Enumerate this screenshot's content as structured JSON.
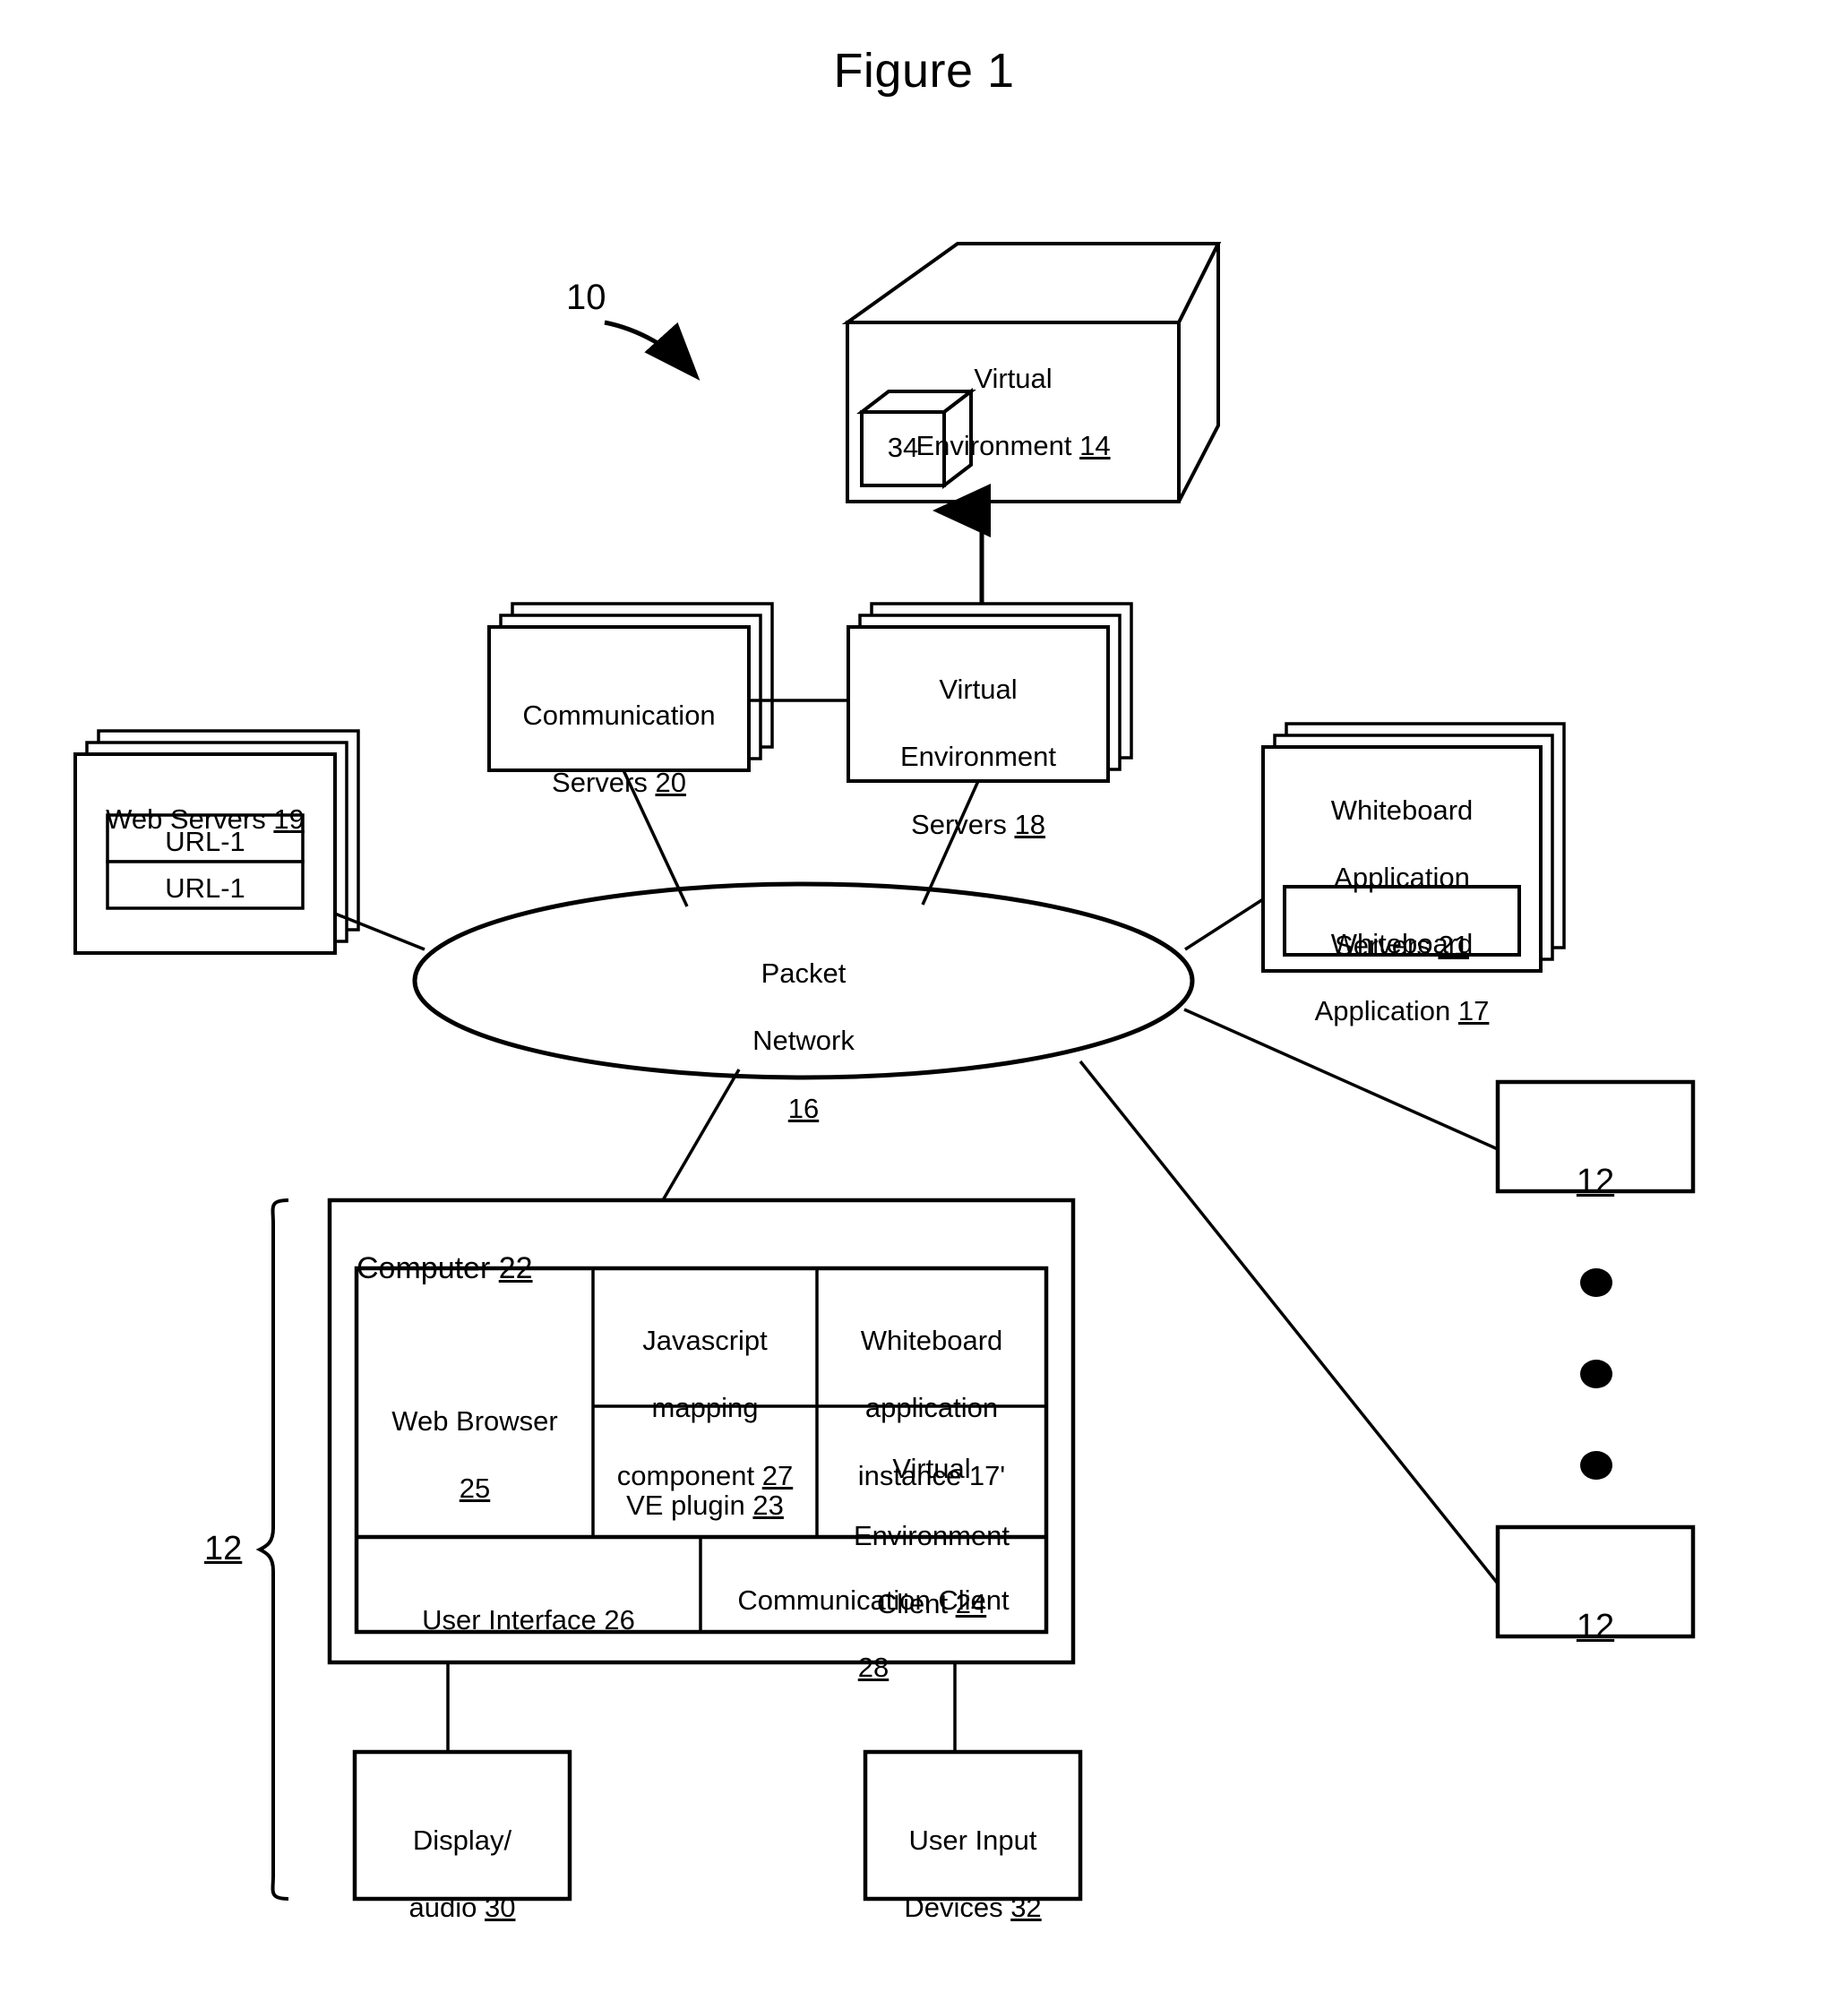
{
  "figure": {
    "title": "Figure 1",
    "system_ref": "10"
  },
  "nodes": {
    "virtual_environment": {
      "line1": "Virtual",
      "line2": "Environment ",
      "ref": "14",
      "inner_cube_label": "34"
    },
    "communication_servers": {
      "line1": "Communication",
      "line2": "Servers ",
      "ref": "20"
    },
    "ve_servers": {
      "line1": "Virtual",
      "line2": "Environment",
      "line3": "Servers ",
      "ref": "18"
    },
    "web_servers": {
      "title": "Web  Servers ",
      "ref": "19",
      "rows": [
        "URL-1",
        "URL-1"
      ]
    },
    "whiteboard_servers": {
      "line1": "Whiteboard",
      "line2": "Application",
      "line3": "Servers ",
      "ref": "21",
      "inner_line1": "Whiteboard",
      "inner_line2": "Application ",
      "inner_ref": "17"
    },
    "packet_network": {
      "line1": "Packet",
      "line2": "Network",
      "ref": "16"
    },
    "computer": {
      "title": "Computer ",
      "ref": "22",
      "bracket_ref": "12",
      "cells": {
        "web_browser": {
          "line1": "Web Browser",
          "ref": "25"
        },
        "javascript_mapping": {
          "line1": "Javascript",
          "line2": "mapping",
          "line3": "component ",
          "ref": "27"
        },
        "whiteboard_instance": {
          "line1": "Whiteboard",
          "line2": "application",
          "line3": "instance 17'"
        },
        "ve_plugin": {
          "line1": "VE plugin ",
          "ref": "23"
        },
        "ve_client": {
          "line1": "Virtual",
          "line2": "Environment",
          "line3": "Client ",
          "ref": "24"
        },
        "user_interface": {
          "line1": "User Interface ",
          "ref": "26"
        },
        "communication_client": {
          "line1": "Communication Client",
          "ref": "28"
        }
      }
    },
    "display_audio": {
      "line1": "Display/",
      "line2": "audio ",
      "ref": "30"
    },
    "user_input_devices": {
      "line1": "User Input",
      "line2": "Devices ",
      "ref": "32"
    },
    "client_top": {
      "ref": "12"
    },
    "client_bottom": {
      "ref": "12"
    },
    "ellipsis_dots": 3
  },
  "colors": {
    "ink": "#000000",
    "paper": "#ffffff"
  }
}
